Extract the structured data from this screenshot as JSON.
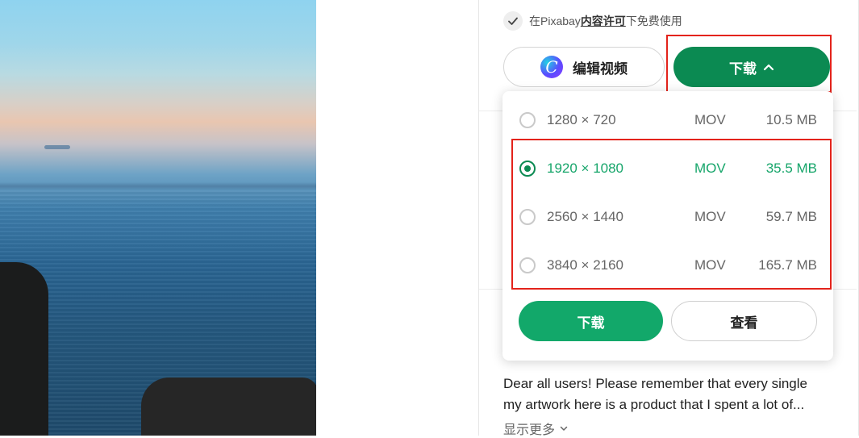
{
  "license": {
    "prefix": "在Pixabay",
    "link": "内容许可",
    "suffix": "下免费使用"
  },
  "edit_button": {
    "label": "编辑视频",
    "logo_letter": "C"
  },
  "download_button": {
    "label": "下载"
  },
  "options": [
    {
      "resolution": "1280 × 720",
      "format": "MOV",
      "size": "10.5 MB",
      "selected": false
    },
    {
      "resolution": "1920 × 1080",
      "format": "MOV",
      "size": "35.5 MB",
      "selected": true
    },
    {
      "resolution": "2560 × 1440",
      "format": "MOV",
      "size": "59.7 MB",
      "selected": false
    },
    {
      "resolution": "3840 × 2160",
      "format": "MOV",
      "size": "165.7 MB",
      "selected": false
    }
  ],
  "dropdown_actions": {
    "download": "下载",
    "view": "查看"
  },
  "description": {
    "line1": "Dear all users! Please remember that every single",
    "line2": "my artwork here is a product that I spent a lot of..."
  },
  "show_more": "显示更多",
  "colors": {
    "primary_green": "#0b8a52",
    "selected_green": "#16a56a",
    "highlight_red": "#e3231b"
  }
}
